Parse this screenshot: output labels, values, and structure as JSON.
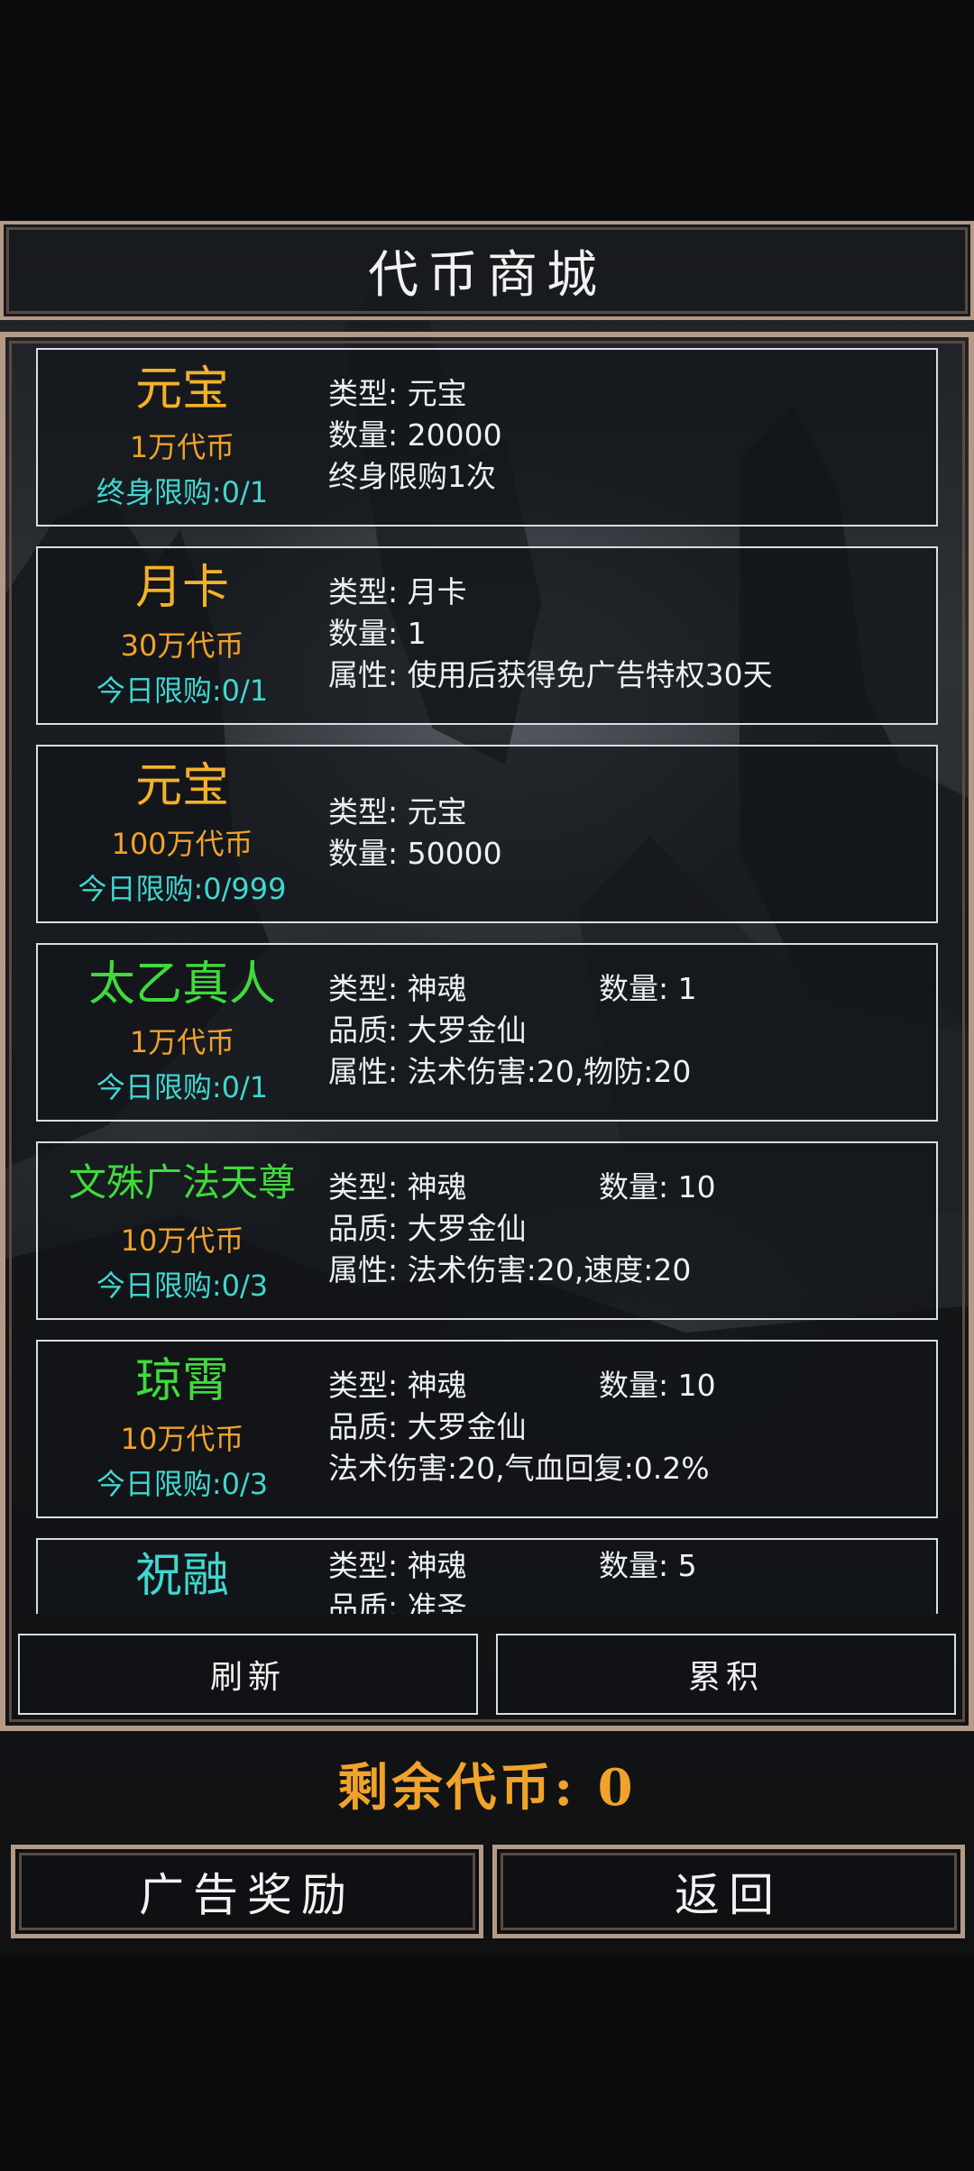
{
  "title": "代币商城",
  "items": [
    {
      "name": "元宝",
      "name_color": "gold",
      "price": "1万代币",
      "limit": "终身限购:0/1",
      "rows": [
        [
          "类型: 元宝",
          ""
        ],
        [
          "数量: 20000",
          ""
        ],
        [
          "终身限购1次",
          ""
        ]
      ]
    },
    {
      "name": "月卡",
      "name_color": "gold",
      "price": "30万代币",
      "limit": "今日限购:0/1",
      "rows": [
        [
          "类型: 月卡",
          ""
        ],
        [
          "数量: 1",
          ""
        ],
        [
          "属性: 使用后获得免广告特权30天",
          ""
        ]
      ]
    },
    {
      "name": "元宝",
      "name_color": "gold",
      "price": "100万代币",
      "limit": "今日限购:0/999",
      "rows": [
        [
          "类型: 元宝",
          ""
        ],
        [
          "数量: 50000",
          ""
        ]
      ]
    },
    {
      "name": "太乙真人",
      "name_color": "green",
      "price": "1万代币",
      "limit": "今日限购:0/1",
      "rows": [
        [
          "类型: 神魂",
          "数量: 1"
        ],
        [
          "品质: 大罗金仙",
          ""
        ],
        [
          "属性: 法术伤害:20,物防:20",
          ""
        ]
      ]
    },
    {
      "name": "文殊广法天尊",
      "name_color": "green",
      "price": "10万代币",
      "limit": "今日限购:0/3",
      "rows": [
        [
          "类型: 神魂",
          "数量: 10"
        ],
        [
          "品质: 大罗金仙",
          ""
        ],
        [
          "属性: 法术伤害:20,速度:20",
          ""
        ]
      ]
    },
    {
      "name": "琼霄",
      "name_color": "green",
      "price": "10万代币",
      "limit": "今日限购:0/3",
      "rows": [
        [
          "类型: 神魂",
          "数量: 10"
        ],
        [
          "品质: 大罗金仙",
          ""
        ],
        [
          "法术伤害:20,气血回复:0.2%",
          ""
        ]
      ]
    },
    {
      "name": "祝融",
      "name_color": "cyan",
      "price": "",
      "limit": "",
      "rows": [
        [
          "类型: 神魂",
          "数量: 5"
        ],
        [
          "品质: 准圣",
          ""
        ]
      ]
    }
  ],
  "buttons": {
    "refresh": "刷新",
    "accumulate": "累积",
    "ad_reward": "广告奖励",
    "back": "返回"
  },
  "remaining": {
    "label": "剩余代币:",
    "value": "0"
  }
}
